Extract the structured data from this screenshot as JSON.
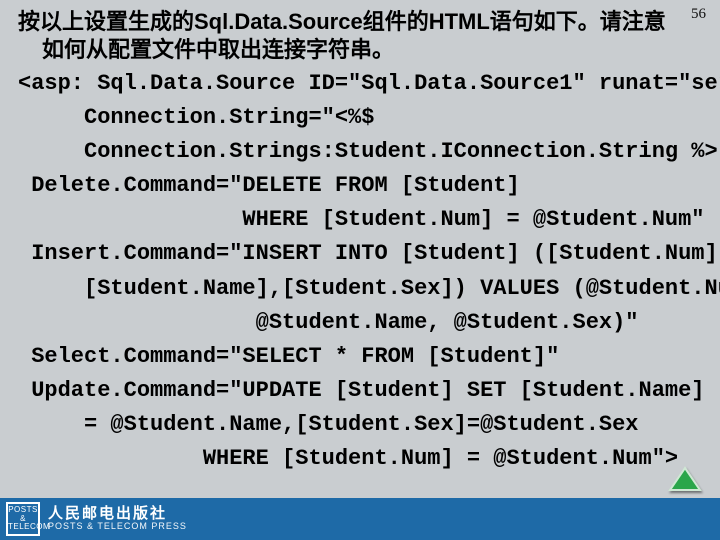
{
  "page_number": "56",
  "intro_line1": "按以上设置生成的Sql.Data.Source组件的HTML语句如下。请注意",
  "intro_line2": "如何从配置文件中取出连接字符串。",
  "code": "<asp: Sql.Data.Source ID=\"Sql.Data.Source1\" runat=\"server\"\n     Connection.String=\"<%$\n     Connection.Strings:Student.IConnection.String %>\"\n Delete.Command=\"DELETE FROM [Student]\n                 WHERE [Student.Num] = @Student.Num\"\n Insert.Command=\"INSERT INTO [Student] ([Student.Num],\n     [Student.Name],[Student.Sex]) VALUES (@Student.Num,\n                  @Student.Name, @Student.Sex)\"\n Select.Command=\"SELECT * FROM [Student]\"\n Update.Command=\"UPDATE [Student] SET [Student.Name]\n     = @Student.Name,[Student.Sex]=@Student.Sex\n              WHERE [Student.Num] = @Student.Num\">",
  "footer": {
    "logo_mark_top": "POSTS &",
    "logo_mark_bottom": "TELECOM",
    "publisher_cn": "人民邮电出版社",
    "publisher_en": "POSTS & TELECOM PRESS"
  },
  "icons": {
    "nav_arrow": "arrow-up-icon"
  },
  "colors": {
    "background": "#c9cdd0",
    "footer_bg": "#1e6aa7",
    "arrow_fill": "#2aa64a",
    "arrow_edge": "#cfe8d4"
  }
}
